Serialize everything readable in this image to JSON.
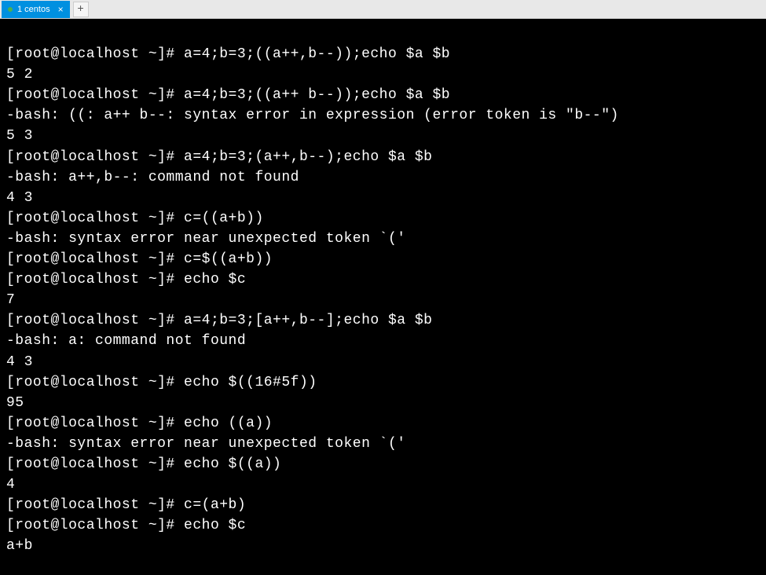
{
  "tabBar": {
    "tabs": [
      {
        "label": "1 centos",
        "active": true
      }
    ]
  },
  "terminal": {
    "prompt": "[root@localhost ~]# ",
    "lines": [
      {
        "type": "prompt",
        "text": "a=4;b=3;((a++,b--));echo $a $b"
      },
      {
        "type": "output",
        "text": "5 2"
      },
      {
        "type": "prompt",
        "text": "a=4;b=3;((a++ b--));echo $a $b"
      },
      {
        "type": "output",
        "text": "-bash: ((: a++ b--: syntax error in expression (error token is \"b--\")"
      },
      {
        "type": "output",
        "text": "5 3"
      },
      {
        "type": "prompt",
        "text": "a=4;b=3;(a++,b--);echo $a $b"
      },
      {
        "type": "output",
        "text": "-bash: a++,b--: command not found"
      },
      {
        "type": "output",
        "text": "4 3"
      },
      {
        "type": "prompt",
        "text": "c=((a+b))"
      },
      {
        "type": "output",
        "text": "-bash: syntax error near unexpected token `('"
      },
      {
        "type": "prompt",
        "text": "c=$((a+b))"
      },
      {
        "type": "prompt",
        "text": "echo $c"
      },
      {
        "type": "output",
        "text": "7"
      },
      {
        "type": "prompt",
        "text": "a=4;b=3;[a++,b--];echo $a $b"
      },
      {
        "type": "output",
        "text": "-bash: a: command not found"
      },
      {
        "type": "output",
        "text": "4 3"
      },
      {
        "type": "prompt",
        "text": "echo $((16#5f))"
      },
      {
        "type": "output",
        "text": "95"
      },
      {
        "type": "prompt",
        "text": "echo ((a))"
      },
      {
        "type": "output",
        "text": "-bash: syntax error near unexpected token `('"
      },
      {
        "type": "prompt",
        "text": "echo $((a))"
      },
      {
        "type": "output",
        "text": "4"
      },
      {
        "type": "prompt",
        "text": "c=(a+b)"
      },
      {
        "type": "prompt",
        "text": "echo $c"
      },
      {
        "type": "output",
        "text": "a+b"
      }
    ]
  }
}
